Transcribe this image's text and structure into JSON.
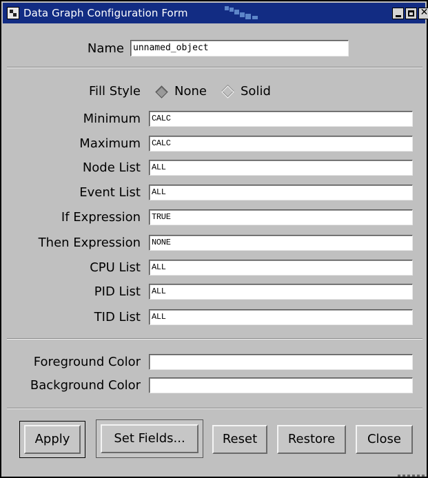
{
  "window": {
    "title": "Data Graph Configuration Form"
  },
  "name_row": {
    "label": "Name",
    "value": "unnamed_object"
  },
  "fill_style": {
    "label": "Fill Style",
    "options": [
      "None",
      "Solid"
    ],
    "selected": "None"
  },
  "fields": [
    {
      "label": "Minimum",
      "value": "CALC"
    },
    {
      "label": "Maximum",
      "value": "CALC"
    },
    {
      "label": "Node List",
      "value": "ALL"
    },
    {
      "label": "Event List",
      "value": "ALL"
    },
    {
      "label": "If Expression",
      "value": "TRUE"
    },
    {
      "label": "Then Expression",
      "value": "NONE"
    },
    {
      "label": "CPU List",
      "value": "ALL"
    },
    {
      "label": "PID List",
      "value": "ALL"
    },
    {
      "label": "TID List",
      "value": "ALL"
    }
  ],
  "colors": {
    "foreground_label": "Foreground Color",
    "foreground_value": "",
    "background_label": "Background Color",
    "background_value": ""
  },
  "buttons": {
    "apply": "Apply",
    "set_fields": "Set Fields...",
    "reset": "Reset",
    "restore": "Restore",
    "close": "Close"
  },
  "theme": {
    "titlebar": "#122c83",
    "window_bg": "#c0c0c0",
    "field_bg": "#ffffff"
  },
  "icons": {
    "app": "app-menu-icon",
    "minimize": "minimize-icon",
    "maximize": "maximize-icon",
    "close": "close-icon"
  }
}
